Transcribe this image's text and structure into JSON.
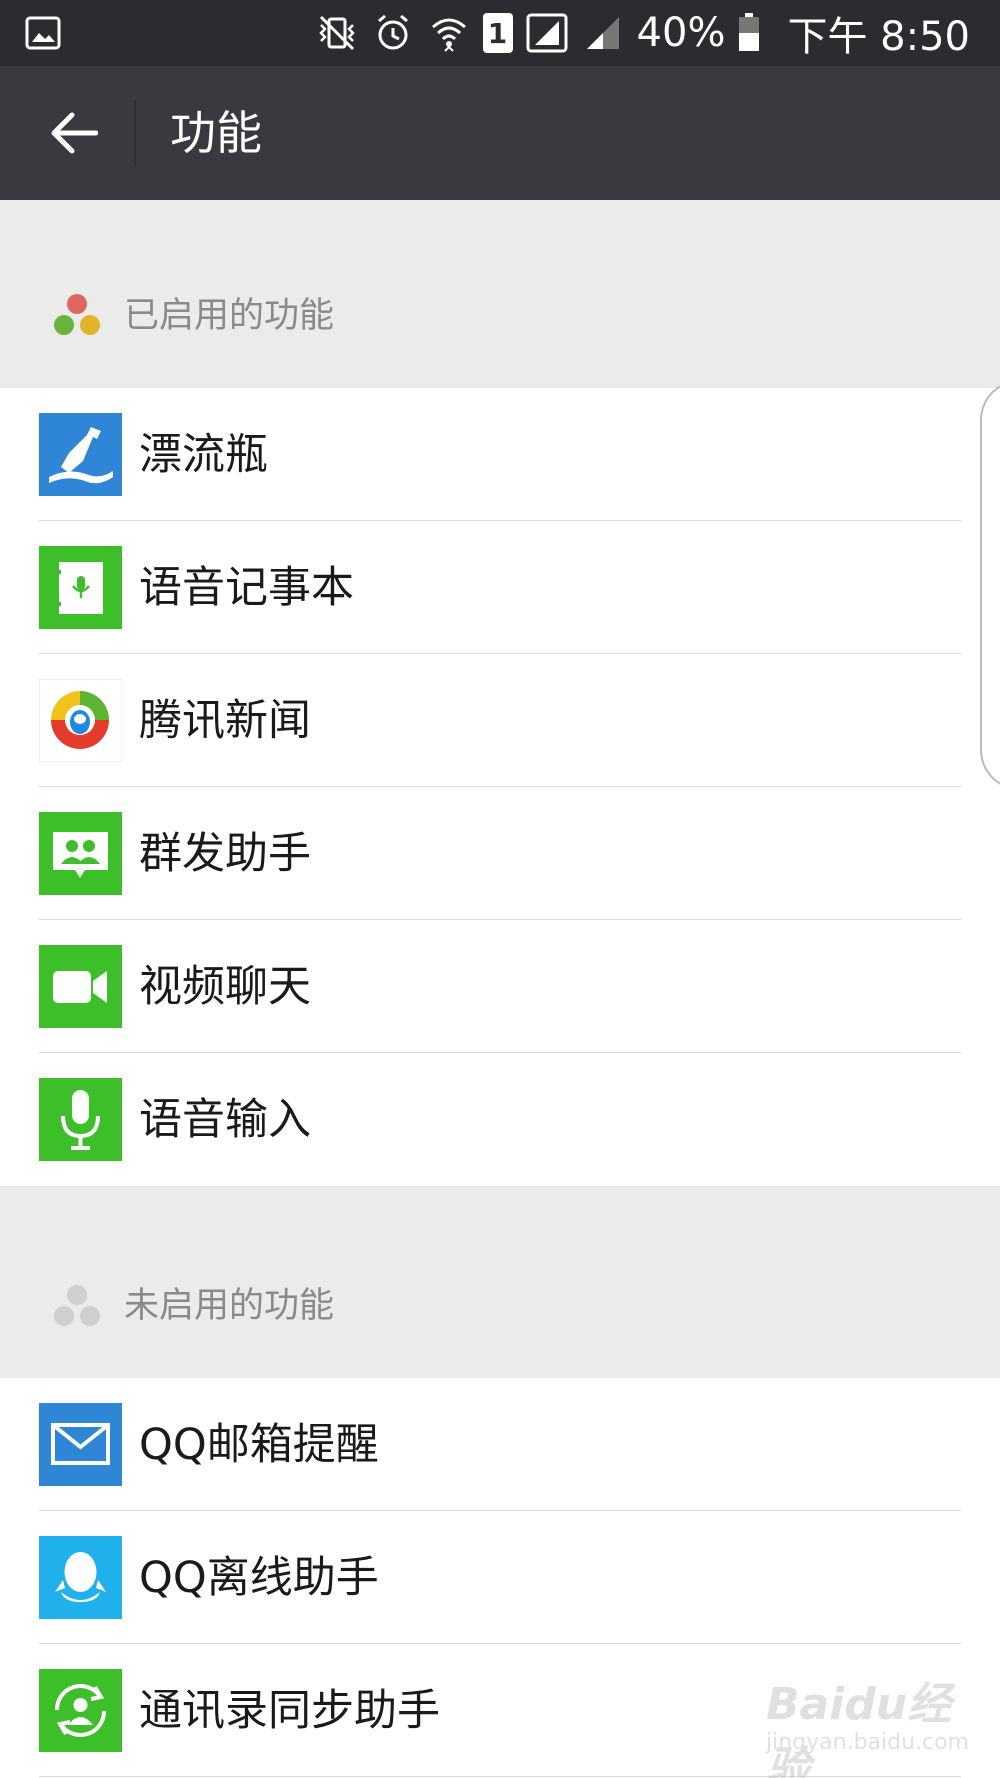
{
  "status_bar": {
    "battery_percent": "40%",
    "time": "下午 8:50",
    "sim_slot": "1",
    "icons": [
      "gallery-icon",
      "vibrate-icon",
      "alarm-icon",
      "wifi-icon",
      "sim-icon",
      "signal-icon",
      "signal-weak-icon",
      "battery-icon"
    ]
  },
  "app_bar": {
    "title": "功能",
    "back_icon": "back-arrow-icon"
  },
  "sections": {
    "enabled": {
      "label": "已启用的功能",
      "icon": "enabled-features-icon",
      "items": [
        {
          "label": "漂流瓶",
          "icon": "drift-bottle-icon",
          "color": "#2f86d6"
        },
        {
          "label": "语音记事本",
          "icon": "voice-notepad-icon",
          "color": "#3dbf2a"
        },
        {
          "label": "腾讯新闻",
          "icon": "tencent-news-icon",
          "color": "#ffffff"
        },
        {
          "label": "群发助手",
          "icon": "broadcast-assistant-icon",
          "color": "#3dbf2a"
        },
        {
          "label": "视频聊天",
          "icon": "video-chat-icon",
          "color": "#3dbf2a"
        },
        {
          "label": "语音输入",
          "icon": "voice-input-icon",
          "color": "#3dbf2a"
        }
      ]
    },
    "disabled": {
      "label": "未启用的功能",
      "icon": "disabled-features-icon",
      "items": [
        {
          "label": "QQ邮箱提醒",
          "icon": "qq-mail-icon",
          "color": "#2f86d6"
        },
        {
          "label": "QQ离线助手",
          "icon": "qq-offline-icon",
          "color": "#20b0ec"
        },
        {
          "label": "通讯录同步助手",
          "icon": "contacts-sync-icon",
          "color": "#3dbf2a"
        }
      ]
    }
  },
  "watermark": {
    "brand": "Baidu经验",
    "url": "jingyan.baidu.com"
  }
}
